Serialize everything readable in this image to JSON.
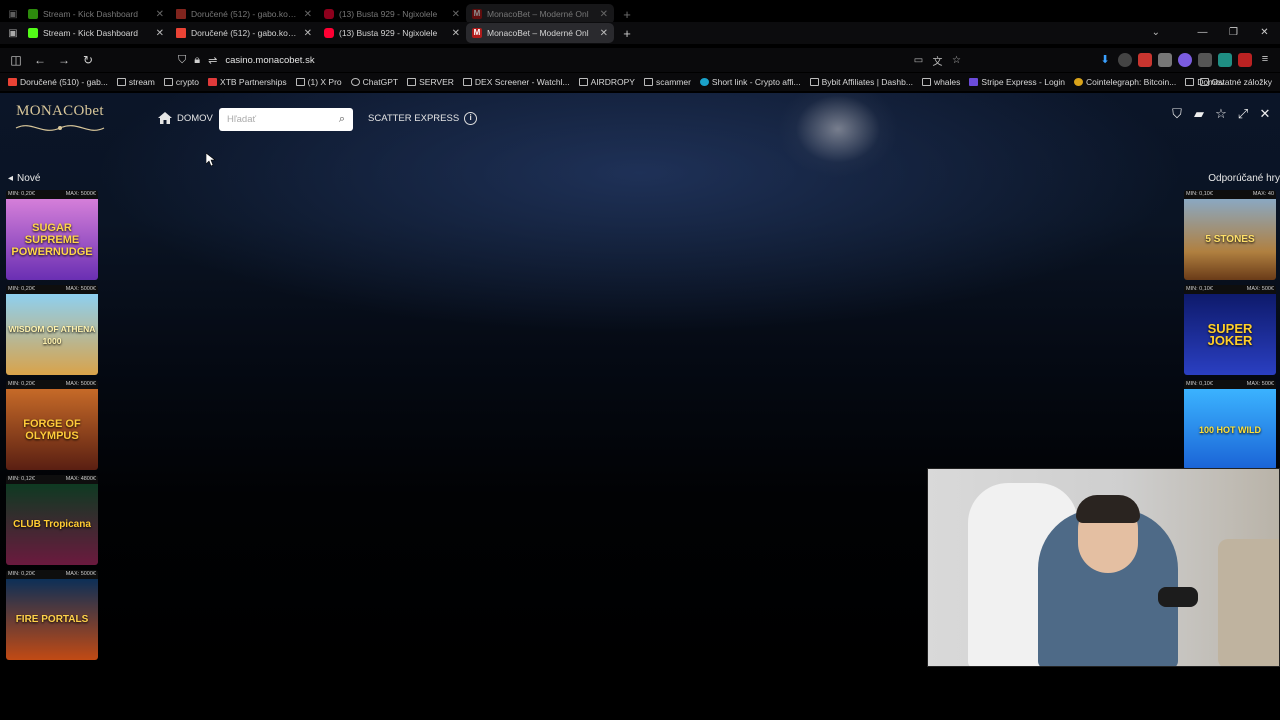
{
  "browser": {
    "tabs": [
      {
        "title": "Stream - Kick Dashboard",
        "icon": "kick-icon",
        "active": false
      },
      {
        "title": "Doručené (512) - gabo.kopcek@",
        "icon": "gmail-icon",
        "active": false
      },
      {
        "title": "(13) Busta 929 - Ngixolele",
        "icon": "youtube-icon",
        "active": false
      },
      {
        "title": "MonacoBet – Moderné Onl",
        "icon": "monacobet-icon",
        "active": true
      }
    ],
    "url": "casino.monacobet.sk",
    "bookmarks": [
      {
        "label": "Doručené (510) - gab...",
        "icon": "gmail-icon"
      },
      {
        "label": "stream",
        "icon": "folder-icon"
      },
      {
        "label": "crypto",
        "icon": "folder-icon"
      },
      {
        "label": "XTB Partnerships",
        "icon": "xtb-icon"
      },
      {
        "label": "(1) X Pro",
        "icon": "x-icon"
      },
      {
        "label": "ChatGPT",
        "icon": "chatgpt-icon"
      },
      {
        "label": "SERVER",
        "icon": "folder-icon"
      },
      {
        "label": "DEX Screener - Watchl...",
        "icon": "dex-icon"
      },
      {
        "label": "AIRDROPY",
        "icon": "folder-icon"
      },
      {
        "label": "scammer",
        "icon": "folder-icon"
      },
      {
        "label": "Short link - Crypto affi...",
        "icon": "link-icon"
      },
      {
        "label": "Bybit Affiliates | Dashb...",
        "icon": "bybit-icon"
      },
      {
        "label": "whales",
        "icon": "folder-icon"
      },
      {
        "label": "Stripe Express - Login",
        "icon": "stripe-icon"
      },
      {
        "label": "Cointelegraph: Bitcoin...",
        "icon": "cointelegraph-icon"
      },
      {
        "label": "Domov",
        "icon": "folder-icon"
      }
    ],
    "other_bookmarks": "Ostatné záložky"
  },
  "site": {
    "logo": "MONACObet",
    "nav_home": "DOMOV",
    "search_placeholder": "Hľadať",
    "scatter": "SCATTER EXPRESS",
    "left_rail": {
      "title": "Nové",
      "games": [
        {
          "min": "MIN: 0,20€",
          "max": "MAX: 5000€",
          "name": "SUGAR SUPREME POWERNUDGE"
        },
        {
          "min": "MIN: 0,20€",
          "max": "MAX: 5000€",
          "name": "WISDOM OF ATHENA 1000"
        },
        {
          "min": "MIN: 0,20€",
          "max": "MAX: 5000€",
          "name": "FORGE OF OLYMPUS"
        },
        {
          "min": "MIN: 0,12€",
          "max": "MAX: 4800€",
          "name": "CLUB Tropicana"
        },
        {
          "min": "MIN: 0,20€",
          "max": "MAX: 5000€",
          "name": "FIRE PORTALS"
        }
      ]
    },
    "right_rail": {
      "title": "Odporúčané hry",
      "games": [
        {
          "min": "MIN: 0,10€",
          "max": "MAX: 40",
          "name": "5 STONES"
        },
        {
          "min": "MIN: 0,10€",
          "max": "MAX: 500€",
          "name": "SUPER JOKER"
        },
        {
          "min": "MIN: 0,10€",
          "max": "MAX: 500€",
          "name": "100 HOT WILD"
        }
      ]
    }
  }
}
